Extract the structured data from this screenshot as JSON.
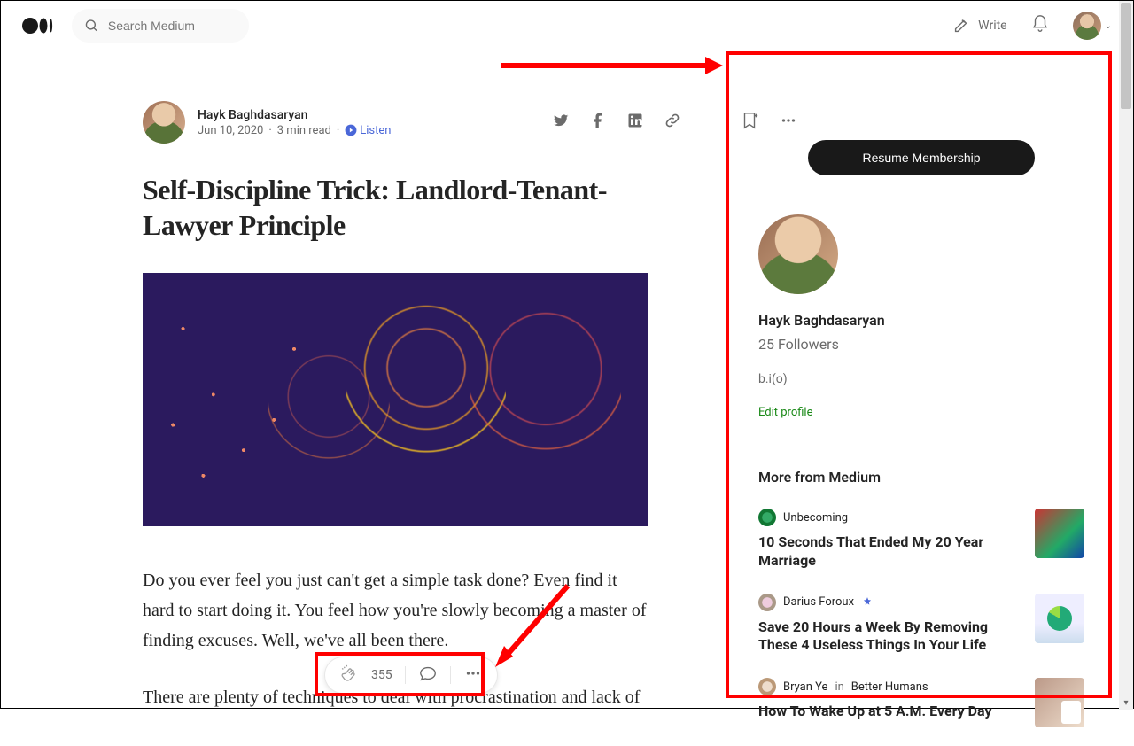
{
  "topbar": {
    "search_placeholder": "Search Medium",
    "write_label": "Write"
  },
  "article": {
    "author": "Hayk Baghdasaryan",
    "date": "Jun 10, 2020",
    "read_time": "3 min read",
    "listen_label": "Listen",
    "title": "Self-Discipline Trick: Landlord-Tenant-Lawyer Principle",
    "body_p1": "Do you ever feel you just can't get a simple task done? Even find it hard to start doing it. You feel how you're slowly becoming a master of finding excuses. Well, we've all been there.",
    "body_p2_partial": "There are plenty of techniques to deal with procrastination and lack of"
  },
  "floatbar": {
    "claps": "355"
  },
  "sidebar": {
    "resume_label": "Resume Membership",
    "profile_name": "Hayk Baghdasaryan",
    "followers": "25 Followers",
    "bio": "b.i(o)",
    "edit_label": "Edit profile",
    "more_heading": "More from Medium",
    "recs": [
      {
        "author": "Unbecoming",
        "title": "10 Seconds That Ended My 20 Year Marriage"
      },
      {
        "author": "Darius Foroux",
        "title": "Save 20 Hours a Week By Removing These 4 Useless Things In Your Life"
      },
      {
        "author": "Bryan Ye",
        "in": "in",
        "publication": "Better Humans",
        "title": "How To Wake Up at 5 A.M. Every Day"
      }
    ]
  }
}
